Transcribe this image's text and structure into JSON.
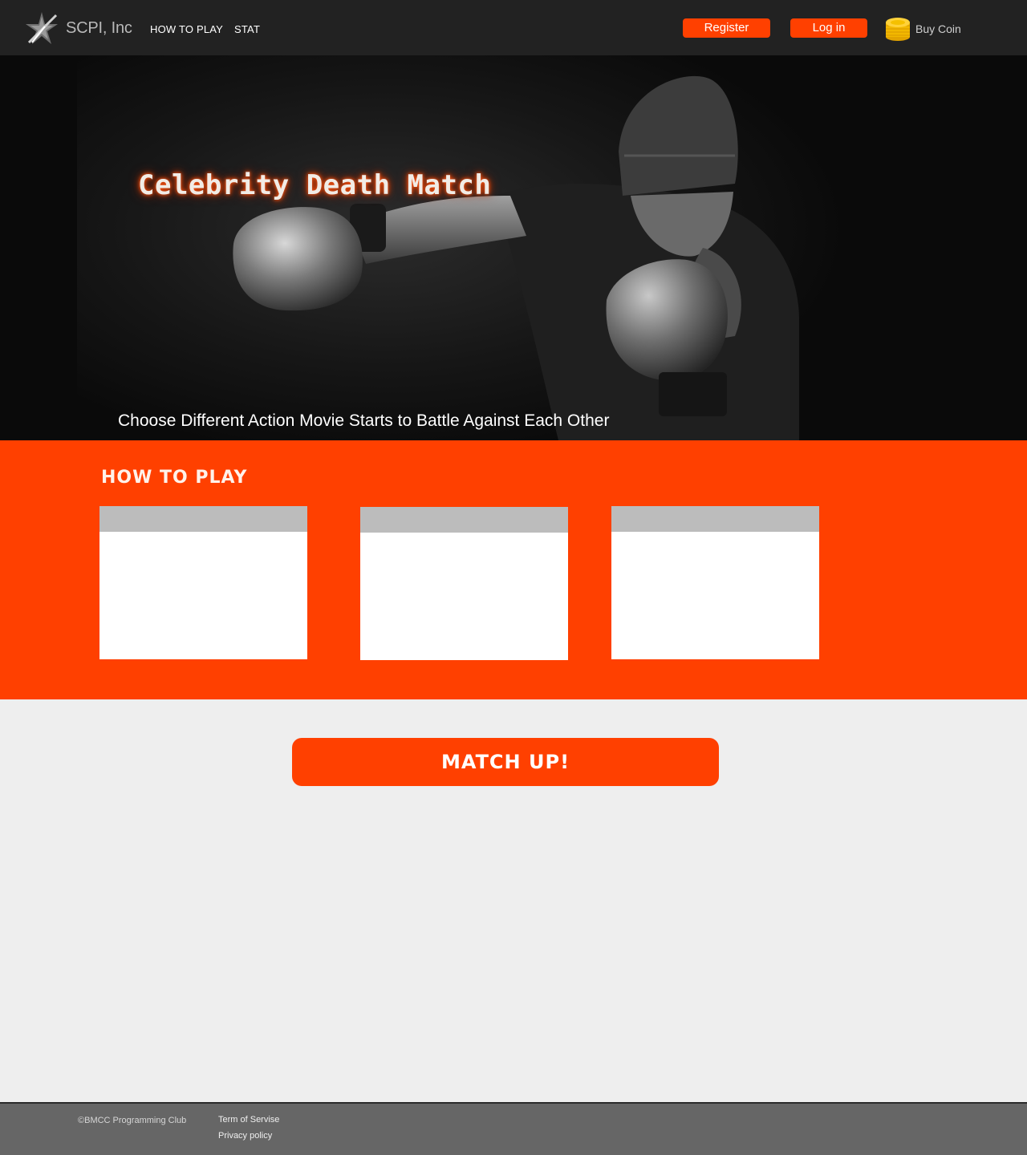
{
  "header": {
    "brand": "SCPI, Inc",
    "nav": [
      {
        "label": "HOW TO PLAY"
      },
      {
        "label": "STAT"
      }
    ],
    "register_label": "Register",
    "login_label": "Log in",
    "buy_coin_label": "Buy Coin"
  },
  "hero": {
    "title": "Celebrity Death Match",
    "subtitle": "Choose Different Action Movie Starts to Battle Against Each Other"
  },
  "how_to_play": {
    "heading": "HOW TO PLAY",
    "cards": [
      {
        "header": "",
        "body": ""
      },
      {
        "header": "",
        "body": ""
      },
      {
        "header": "",
        "body": ""
      }
    ]
  },
  "match_button_label": "MATCH UP!",
  "footer": {
    "copyright": "©BMCC Programming Club",
    "links": [
      {
        "label": "Term of Servise"
      },
      {
        "label": "Privacy policy"
      }
    ]
  },
  "colors": {
    "accent": "#ff4000",
    "header_bg": "#222222",
    "page_bg": "#eeeeee",
    "footer_bg": "#666666",
    "card_header": "#bcbcbc"
  }
}
